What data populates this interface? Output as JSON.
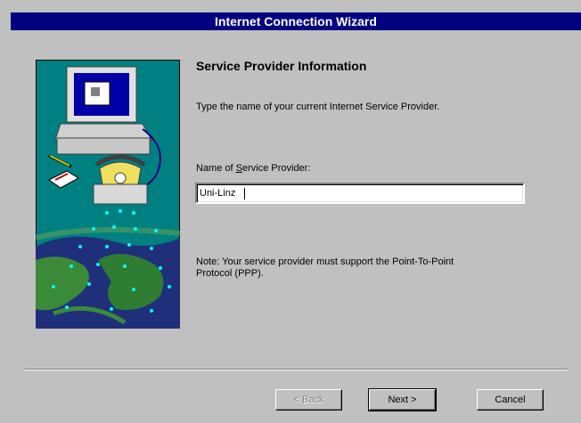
{
  "window": {
    "title": "Internet Connection Wizard"
  },
  "page": {
    "heading": "Service Provider Information",
    "instruction": "Type the name of your current Internet Service Provider.",
    "field_label_prefix": "Name of ",
    "field_label_accel": "S",
    "field_label_rest": "ervice Provider:",
    "field_value": "Uni-Linz",
    "note": "Note: Your service provider must support the Point-To-Point Protocol (PPP)."
  },
  "buttons": {
    "back": "< Back",
    "next": "Next >",
    "cancel": "Cancel"
  },
  "colors": {
    "title_bar": "#000080",
    "dialog_bg": "#c0c0c0",
    "art_bg": "#008080"
  },
  "illustration": {
    "icon": "computer-phone-globe-illustration"
  }
}
